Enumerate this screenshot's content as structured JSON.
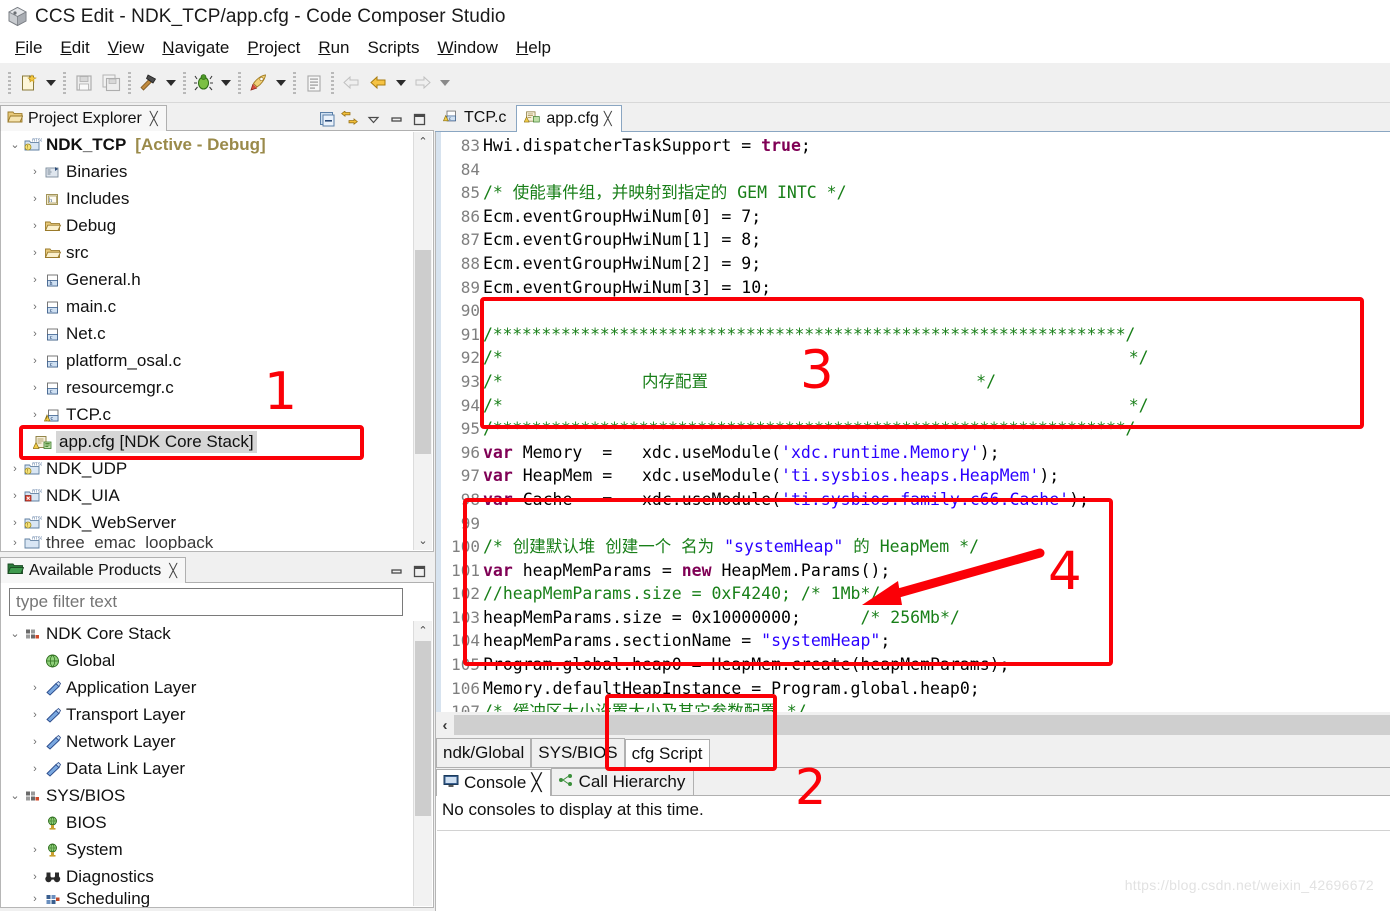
{
  "window": {
    "title": "CCS Edit - NDK_TCP/app.cfg - Code Composer Studio",
    "app_icon": "ccs-cube-icon"
  },
  "menu": {
    "items": [
      {
        "label": "File",
        "mnemonic": "F"
      },
      {
        "label": "Edit",
        "mnemonic": "E"
      },
      {
        "label": "View",
        "mnemonic": "V"
      },
      {
        "label": "Navigate",
        "mnemonic": "N"
      },
      {
        "label": "Project",
        "mnemonic": "P"
      },
      {
        "label": "Run",
        "mnemonic": "R"
      },
      {
        "label": "Scripts",
        "mnemonic": ""
      },
      {
        "label": "Window",
        "mnemonic": "W"
      },
      {
        "label": "Help",
        "mnemonic": "H"
      }
    ]
  },
  "toolbar": {
    "groups": [
      {
        "buttons": [
          {
            "icon": "new-file-icon",
            "enabled": true,
            "dropdown": true
          }
        ]
      },
      {
        "buttons": [
          {
            "icon": "save-icon",
            "enabled": false,
            "dropdown": false
          },
          {
            "icon": "save-all-icon",
            "enabled": false,
            "dropdown": false
          }
        ]
      },
      {
        "buttons": [
          {
            "icon": "build-hammer-icon",
            "enabled": true,
            "dropdown": true
          }
        ]
      },
      {
        "buttons": [
          {
            "icon": "debug-bug-icon",
            "enabled": true,
            "dropdown": true
          }
        ]
      },
      {
        "buttons": [
          {
            "icon": "run-rocket-icon",
            "enabled": true,
            "dropdown": true
          }
        ]
      },
      {
        "buttons": [
          {
            "icon": "properties-icon",
            "enabled": false,
            "dropdown": false
          }
        ]
      },
      {
        "buttons": [
          {
            "icon": "back-arrow-dim-icon",
            "enabled": false,
            "dropdown": false
          },
          {
            "icon": "back-arrow-icon",
            "enabled": true,
            "dropdown": true
          },
          {
            "icon": "forward-arrow-icon",
            "enabled": false,
            "dropdown": true
          }
        ]
      }
    ]
  },
  "project_explorer": {
    "tab_label": "Project Explorer",
    "tab_icon": "project-explorer-icon",
    "close_glyph": "╳",
    "view_tools": [
      {
        "icon": "collapse-all-icon"
      },
      {
        "icon": "link-with-editor-icon"
      },
      {
        "icon": "view-menu-icon"
      },
      {
        "icon": "minimize-icon"
      },
      {
        "icon": "maximize-icon"
      }
    ],
    "tree": [
      {
        "label": "NDK_TCP",
        "suffix": "[Active - Debug]",
        "icon": "rtsc-project-icon",
        "indent": 1,
        "twist": "⌄",
        "bold": true,
        "selected": false
      },
      {
        "label": "Binaries",
        "suffix": "",
        "icon": "binaries-icon",
        "indent": 2,
        "twist": "›",
        "bold": false,
        "selected": false
      },
      {
        "label": "Includes",
        "suffix": "",
        "icon": "includes-icon",
        "indent": 2,
        "twist": "›",
        "bold": false,
        "selected": false
      },
      {
        "label": "Debug",
        "suffix": "",
        "icon": "folder-icon",
        "indent": 2,
        "twist": "›",
        "bold": false,
        "selected": false
      },
      {
        "label": "src",
        "suffix": "",
        "icon": "folder-icon",
        "indent": 2,
        "twist": "›",
        "bold": false,
        "selected": false
      },
      {
        "label": "General.h",
        "suffix": "",
        "icon": "header-file-icon",
        "indent": 2,
        "twist": "›",
        "bold": false,
        "selected": false
      },
      {
        "label": "main.c",
        "suffix": "",
        "icon": "c-file-icon",
        "indent": 2,
        "twist": "›",
        "bold": false,
        "selected": false
      },
      {
        "label": "Net.c",
        "suffix": "",
        "icon": "c-file-icon",
        "indent": 2,
        "twist": "›",
        "bold": false,
        "selected": false
      },
      {
        "label": "platform_osal.c",
        "suffix": "",
        "icon": "c-file-icon",
        "indent": 2,
        "twist": "›",
        "bold": false,
        "selected": false
      },
      {
        "label": "resourcemgr.c",
        "suffix": "",
        "icon": "c-file-icon",
        "indent": 2,
        "twist": "›",
        "bold": false,
        "selected": false
      },
      {
        "label": "TCP.c",
        "suffix": "",
        "icon": "c-file-warning-icon",
        "indent": 2,
        "twist": "›",
        "bold": false,
        "selected": false
      },
      {
        "label": "app.cfg [NDK Core Stack]",
        "suffix": "",
        "icon": "cfg-file-icon",
        "indent": 2,
        "twist": "",
        "bold": false,
        "selected": true
      },
      {
        "label": "NDK_UDP",
        "suffix": "",
        "icon": "rtsc-project-icon",
        "indent": 1,
        "twist": "›",
        "bold": false,
        "selected": false
      },
      {
        "label": "NDK_UIA",
        "suffix": "",
        "icon": "rtsc-project-error-icon",
        "indent": 1,
        "twist": "›",
        "bold": false,
        "selected": false
      },
      {
        "label": "NDK_WebServer",
        "suffix": "",
        "icon": "rtsc-project-icon",
        "indent": 1,
        "twist": "›",
        "bold": false,
        "selected": false
      }
    ],
    "clipped_row_label": "three_emac_loopback"
  },
  "available_products": {
    "tab_label": "Available Products",
    "tab_icon": "available-products-icon",
    "close_glyph": "╳",
    "view_tools": [
      {
        "icon": "minimize-icon"
      },
      {
        "icon": "maximize-icon"
      }
    ],
    "filter_placeholder": "type filter text",
    "filter_value": "",
    "tree": [
      {
        "label": "NDK Core Stack",
        "icon": "repository-icon",
        "indent": 1,
        "twist": "⌄"
      },
      {
        "label": "Global",
        "icon": "globe-icon",
        "indent": 2,
        "twist": ""
      },
      {
        "label": "Application Layer",
        "icon": "module-icon",
        "indent": 2,
        "twist": "›"
      },
      {
        "label": "Transport Layer",
        "icon": "module-icon",
        "indent": 2,
        "twist": "›"
      },
      {
        "label": "Network Layer",
        "icon": "module-icon",
        "indent": 2,
        "twist": "›"
      },
      {
        "label": "Data Link Layer",
        "icon": "module-icon",
        "indent": 2,
        "twist": "›"
      },
      {
        "label": "SYS/BIOS",
        "icon": "repository-icon",
        "indent": 1,
        "twist": "⌄"
      },
      {
        "label": "BIOS",
        "icon": "bios-icon",
        "indent": 2,
        "twist": ""
      },
      {
        "label": "System",
        "icon": "bios-icon",
        "indent": 2,
        "twist": "›"
      },
      {
        "label": "Diagnostics",
        "icon": "diagnostics-icon",
        "indent": 2,
        "twist": "›"
      },
      {
        "label": "Scheduling",
        "icon": "scheduling-icon",
        "indent": 2,
        "twist": "›"
      }
    ]
  },
  "editor": {
    "tabs": [
      {
        "label": "TCP.c",
        "icon": "c-file-warning-icon",
        "active": false,
        "closable": false
      },
      {
        "label": "app.cfg",
        "icon": "cfg-file-icon",
        "active": true,
        "closable": true
      }
    ],
    "close_glyph": "╳",
    "first_line_number": 83,
    "lines": [
      {
        "n": 83,
        "tokens": [
          {
            "t": "Hwi.dispatcherTaskSupport = ",
            "c": "ctext"
          },
          {
            "t": "true",
            "c": "lit"
          },
          {
            "t": ";",
            "c": "ctext"
          }
        ]
      },
      {
        "n": 84,
        "tokens": []
      },
      {
        "n": 85,
        "tokens": [
          {
            "t": "/* 使能事件组，并映射到指定的 GEM INTC */",
            "c": "cm"
          }
        ]
      },
      {
        "n": 86,
        "tokens": [
          {
            "t": "Ecm.eventGroupHwiNum[0] = 7;",
            "c": "ctext"
          }
        ]
      },
      {
        "n": 87,
        "tokens": [
          {
            "t": "Ecm.eventGroupHwiNum[1] = 8;",
            "c": "ctext"
          }
        ]
      },
      {
        "n": 88,
        "tokens": [
          {
            "t": "Ecm.eventGroupHwiNum[2] = 9;",
            "c": "ctext"
          }
        ]
      },
      {
        "n": 89,
        "tokens": [
          {
            "t": "Ecm.eventGroupHwiNum[3] = 10;",
            "c": "ctext"
          }
        ]
      },
      {
        "n": 90,
        "tokens": []
      },
      {
        "n": 91,
        "tokens": [
          {
            "t": "/*****************************************************************/",
            "c": "stars"
          }
        ]
      },
      {
        "n": 92,
        "tokens": [
          {
            "t": "/*                                                               */",
            "c": "cm"
          }
        ]
      },
      {
        "n": 93,
        "tokens": [
          {
            "t": "/*              内存配置                           */",
            "c": "cm"
          }
        ]
      },
      {
        "n": 94,
        "tokens": [
          {
            "t": "/*                                                               */",
            "c": "cm"
          }
        ]
      },
      {
        "n": 95,
        "tokens": [
          {
            "t": "/*****************************************************************/",
            "c": "stars"
          }
        ]
      },
      {
        "n": 96,
        "tokens": [
          {
            "t": "var",
            "c": "kw"
          },
          {
            "t": " Memory  =   xdc.useModule(",
            "c": "ctext"
          },
          {
            "t": "'xdc.runtime.Memory'",
            "c": "str"
          },
          {
            "t": ");",
            "c": "ctext"
          }
        ]
      },
      {
        "n": 97,
        "tokens": [
          {
            "t": "var",
            "c": "kw"
          },
          {
            "t": " HeapMem =   xdc.useModule(",
            "c": "ctext"
          },
          {
            "t": "'ti.sysbios.heaps.HeapMem'",
            "c": "str"
          },
          {
            "t": ");",
            "c": "ctext"
          }
        ]
      },
      {
        "n": 98,
        "tokens": [
          {
            "t": "var",
            "c": "kw"
          },
          {
            "t": " Cache   =   xdc.useModule(",
            "c": "ctext"
          },
          {
            "t": "'ti.sysbios.family.c66.Cache'",
            "c": "str"
          },
          {
            "t": ");",
            "c": "ctext"
          }
        ]
      },
      {
        "n": 99,
        "tokens": []
      },
      {
        "n": 100,
        "tokens": [
          {
            "t": "/* 创建默认堆 创建一个 名为 ",
            "c": "cm"
          },
          {
            "t": "\"systemHeap\"",
            "c": "str"
          },
          {
            "t": " 的 HeapMem */",
            "c": "cm"
          }
        ]
      },
      {
        "n": 101,
        "tokens": [
          {
            "t": "var",
            "c": "kw"
          },
          {
            "t": " heapMemParams = ",
            "c": "ctext"
          },
          {
            "t": "new",
            "c": "kw"
          },
          {
            "t": " HeapMem.Params();",
            "c": "ctext"
          }
        ]
      },
      {
        "n": 102,
        "tokens": [
          {
            "t": "//heapMemParams.size = 0xF4240; /* 1Mb*/",
            "c": "cm"
          }
        ]
      },
      {
        "n": 103,
        "tokens": [
          {
            "t": "heapMemParams.size = 0x10000000;      ",
            "c": "ctext"
          },
          {
            "t": "/* 256Mb*/",
            "c": "cm"
          }
        ]
      },
      {
        "n": 104,
        "tokens": [
          {
            "t": "heapMemParams.sectionName = ",
            "c": "ctext"
          },
          {
            "t": "\"systemHeap\"",
            "c": "str"
          },
          {
            "t": ";",
            "c": "ctext"
          }
        ]
      },
      {
        "n": 105,
        "tokens": [
          {
            "t": "Program.global.heap0 = HeapMem.create(heapMemParams);",
            "c": "ctext"
          }
        ]
      },
      {
        "n": 106,
        "tokens": [
          {
            "t": "Memory.defaultHeapInstance = Program.global.heap0;",
            "c": "ctext"
          }
        ]
      },
      {
        "n": 107,
        "tokens": [
          {
            "t": "/* 缓冲区大小设置大小及其它参数配置 */",
            "c": "cm"
          }
        ]
      }
    ]
  },
  "config_tabs": {
    "tabs": [
      {
        "label": "ndk/Global",
        "active": false
      },
      {
        "label": "SYS/BIOS",
        "active": false
      },
      {
        "label": "cfg Script",
        "active": true
      }
    ],
    "back_glyph": "‹"
  },
  "bottom_panel": {
    "tabs": [
      {
        "label": "Console",
        "icon": "console-icon",
        "active": true,
        "closable": true
      },
      {
        "label": "Call Hierarchy",
        "icon": "call-hierarchy-icon",
        "active": false,
        "closable": false
      }
    ],
    "close_glyph": "╳",
    "message": "No consoles to display at this time."
  },
  "annotations": {
    "color": "#fb0007",
    "items": [
      {
        "number": "1",
        "target": "app-cfg-tree-row"
      },
      {
        "number": "2",
        "target": "cfg-script-tab"
      },
      {
        "number": "3",
        "target": "memory-config-comment-block"
      },
      {
        "number": "4",
        "target": "heap-size-code-block"
      }
    ]
  },
  "watermark": "https://blog.csdn.net/weixin_42696672"
}
